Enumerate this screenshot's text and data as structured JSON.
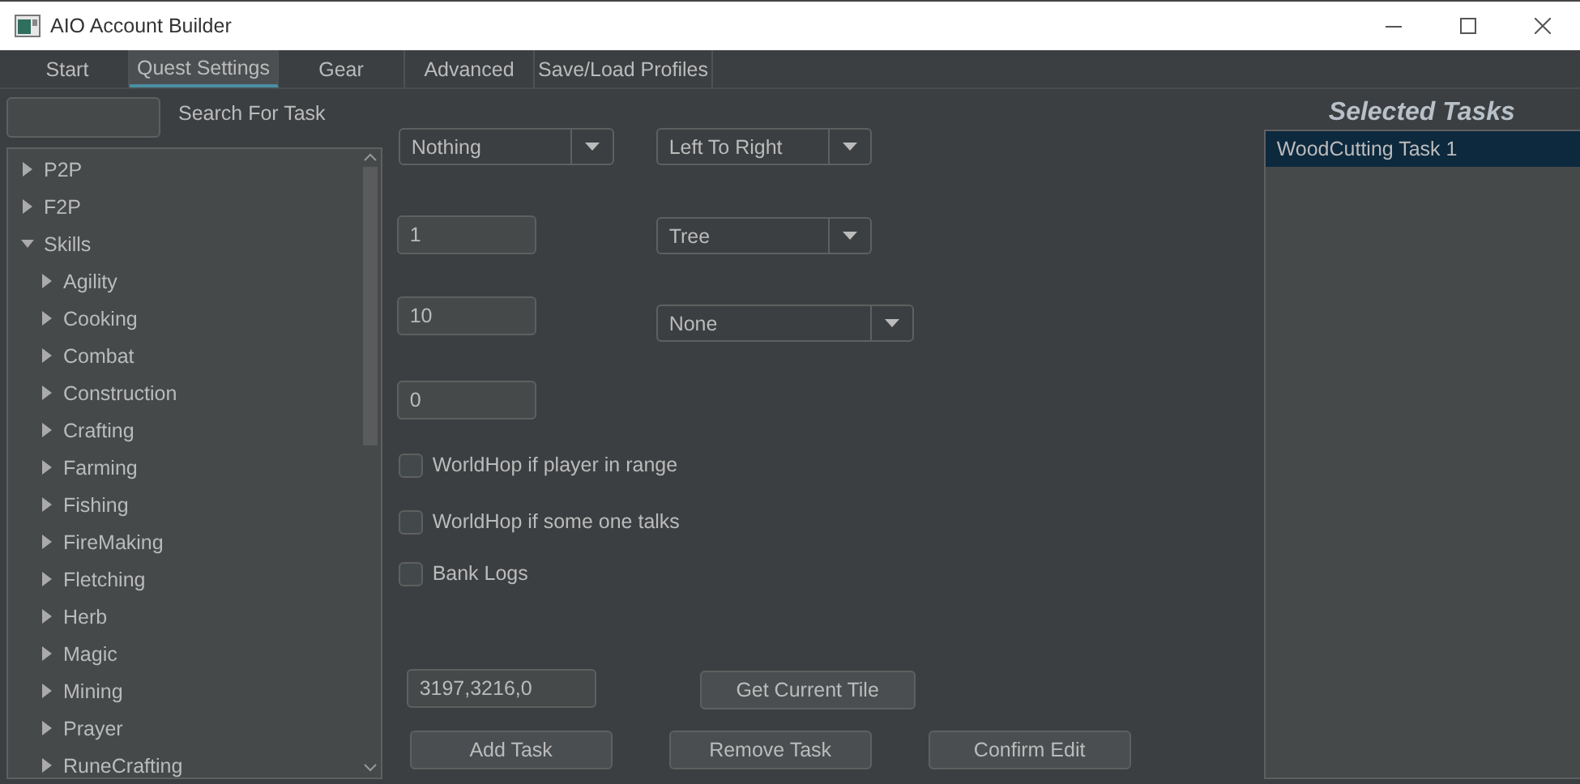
{
  "window": {
    "title": "AIO Account Builder"
  },
  "tabs": [
    {
      "label": "Start",
      "selected": false
    },
    {
      "label": "Quest Settings",
      "selected": true
    },
    {
      "label": "Gear",
      "selected": false
    },
    {
      "label": "Advanced",
      "selected": false
    },
    {
      "label": "Save/Load Profiles",
      "selected": false
    }
  ],
  "search": {
    "label": "Search For Task"
  },
  "tree": [
    {
      "label": "P2P",
      "expanded": false
    },
    {
      "label": "F2P",
      "expanded": false
    },
    {
      "label": "Skills",
      "expanded": true,
      "children": [
        {
          "label": "Agility",
          "expanded": false
        },
        {
          "label": "Cooking",
          "expanded": false
        },
        {
          "label": "Combat",
          "expanded": false
        },
        {
          "label": "Construction",
          "expanded": false
        },
        {
          "label": "Crafting",
          "expanded": false
        },
        {
          "label": "Farming",
          "expanded": false
        },
        {
          "label": "Fishing",
          "expanded": false
        },
        {
          "label": "FireMaking",
          "expanded": false
        },
        {
          "label": "Fletching",
          "expanded": false
        },
        {
          "label": "Herb",
          "expanded": false
        },
        {
          "label": "Magic",
          "expanded": false
        },
        {
          "label": "Mining",
          "expanded": false
        },
        {
          "label": "Prayer",
          "expanded": false
        },
        {
          "label": "RuneCrafting",
          "expanded": false
        }
      ]
    }
  ],
  "dropdowns": [
    {
      "value": "Nothing"
    },
    {
      "value": "Left To Right"
    },
    {
      "value": "Tree"
    },
    {
      "value": "None"
    }
  ],
  "fields": [
    {
      "value": "1"
    },
    {
      "value": "10"
    },
    {
      "value": "0"
    }
  ],
  "checkboxes": [
    {
      "label": "WorldHop if player in range",
      "checked": false
    },
    {
      "label": "WorldHop if some one talks",
      "checked": false
    },
    {
      "label": "Bank Logs",
      "checked": false
    }
  ],
  "tile_field": {
    "value": "3197,3216,0"
  },
  "tile_button": "Get Current Tile",
  "buttons": [
    "Add Task",
    "Remove Task",
    "Confirm Edit"
  ],
  "selected_tasks": {
    "title": "Selected Tasks",
    "items": [
      {
        "label": "WoodCutting Task 1",
        "selected": true
      }
    ]
  }
}
